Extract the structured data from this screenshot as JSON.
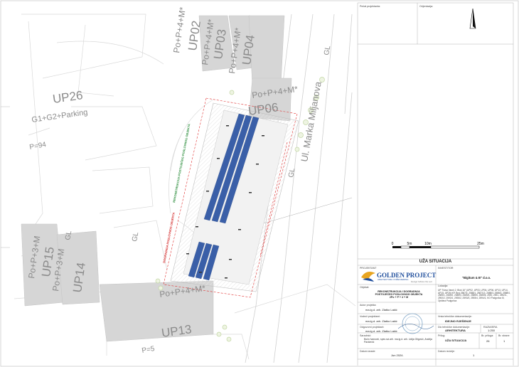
{
  "plan": {
    "zones": [
      {
        "code": "UP02",
        "floors": "Po+P+4+M*"
      },
      {
        "code": "UP03",
        "floors": "Po+P+4+M*"
      },
      {
        "code": "UP04",
        "floors": "Po+P+4+M*"
      },
      {
        "code": "UP06",
        "floors": "Po+P+4+M*"
      },
      {
        "code": "UP26",
        "floors": "G1+G2+Parking"
      },
      {
        "code": "UP15",
        "floors": "Po+P+3+M"
      },
      {
        "code": "UP14",
        "floors": "Po+P+3+M"
      },
      {
        "code": "UP13",
        "floors": "Po+P+4+M*"
      }
    ],
    "street_name": "Ul. Marka Miljanova",
    "gl_mark": "GL",
    "parcel_p94": "P=94",
    "parcel_p5": "P=5",
    "reconstruction_label": "REKONSTRUKCIJA POSTOJEĆEG POSLOVNOG OBJEKTA",
    "addition_label": "DOGRADNJA POSLOVNOG OBJEKTA"
  },
  "scale_bar": {
    "ticks": [
      "0",
      "5m",
      "10m",
      "25m"
    ]
  },
  "title_block": {
    "field_pecat": "Pečat projektanta:",
    "field_orijentacija": "Orijentacija:",
    "drawing_title": "UŽA SITUACIJA",
    "label_projektant": "PROJEKTANT",
    "label_investitor": "INVESTITOR",
    "investor_name": "\"Bigitum & B\" d.o.o.",
    "company_name": "GOLDEN PROJECT",
    "company_sub": "ARHITEKTURA I INŽENJERING",
    "company_tagline": "Design follows the sun",
    "label_objekat": "Objekat:",
    "object_name": "REKONSTRUKCIJA I DOGRADNJA POSTOJEĆEG POSLOVNOG OBJEKTA 2Po + P + 4 + M",
    "label_lokacija": "Lokacija:",
    "location_text": "UP \"Nova Varoš 2, Blok 16\" (UP02, UP03, UP04, UP06, UP13, UP14, UP15, UP26) KP. Broj 2587/4, 2588/1, 2587/13, 2588/3, 2588/2, 2588/4, 2589/1, 2589/2, 2589/3, 2589/4, 2589/5, 2589/6, 2590, 2591, 2592/1, 2592/2, 2593/1, 2593/2, 2593/3, 2593/4, 2594/1, KO Podgorica III, Opština Podgorica",
    "label_autor": "Autor projekta:",
    "autor": "ma.ig.d. arh. Zlatko Lakić",
    "label_vodeci": "Vodeći projektant:",
    "vodeci": "ma.ig.d. arh. Zlatko Lakić",
    "label_odgovorni": "Odgovorni projektant:",
    "odgovorni": "ma.ig.d. arh. Zlatko Lakić",
    "label_saradnici": "Saradnici:",
    "saradnici": "Božo Ivanović, spec.sci.arh. ma.ig.d. arh. Lidija Gligović, Andrija Pavićević",
    "label_vrsta_tehnicke": "Vrsta tehničke dokumentacije:",
    "vrsta_tehnicke": "IDEJNO RJEŠENJE",
    "label_dio": "Dio tehničke dokumentacije:",
    "dio": "ARHITEKTURA",
    "label_razmjera": "RAZMJERA",
    "razmjera": "1:250",
    "label_prilog": "Prilog:",
    "prilog": "UŽA SITUACIJA",
    "label_br_priloga": "Br. priloga:",
    "br_priloga": "26",
    "label_br_strane": "Br. strane:",
    "br_strane": "1",
    "label_datum_izrade": "Datum izrade:",
    "datum_izrade": "Jun 2024.",
    "label_datum_revizije": "Datum revizije:",
    "datum_revizije": "1"
  },
  "colors": {
    "solar_blue": "#3a5fa8",
    "building_gray": "#d4d4d4",
    "line_gray": "#cfcfcf",
    "red_dash": "#e03030",
    "green": "#3aa34a",
    "brand_blue": "#1f4e9c",
    "brand_gold": "#e8a521"
  }
}
